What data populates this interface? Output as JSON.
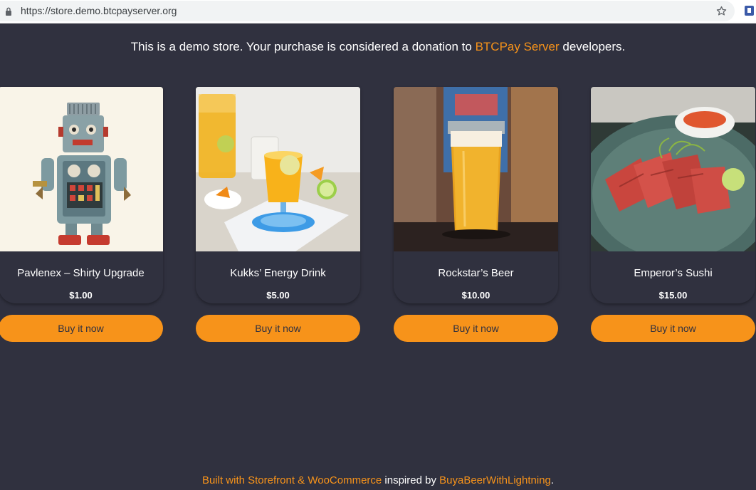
{
  "browser": {
    "url": "https://store.demo.btcpayserver.org"
  },
  "banner": {
    "text_before": "This is a demo store. Your purchase is considered a donation to ",
    "link": "BTCPay Server",
    "text_after": " developers."
  },
  "products": [
    {
      "title": "Pavlenex – Shirty Upgrade",
      "price": "$1.00",
      "image": "tin-robot-toy",
      "button": "Buy it now"
    },
    {
      "title": "Kukks’ Energy Drink",
      "price": "$5.00",
      "image": "orange-drinks",
      "button": "Buy it now"
    },
    {
      "title": "Rockstar’s Beer",
      "price": "$10.00",
      "image": "pint-of-beer",
      "button": "Buy it now"
    },
    {
      "title": "Emperor’s Sushi",
      "price": "$15.00",
      "image": "seared-tuna-plate",
      "button": "Buy it now"
    }
  ],
  "footer": {
    "link1": "Built with Storefront & WooCommerce",
    "middle": " inspired by ",
    "link2": "BuyaBeerWithLightning",
    "end": "."
  },
  "colors": {
    "background": "#30313f",
    "accent": "#f7931a"
  }
}
